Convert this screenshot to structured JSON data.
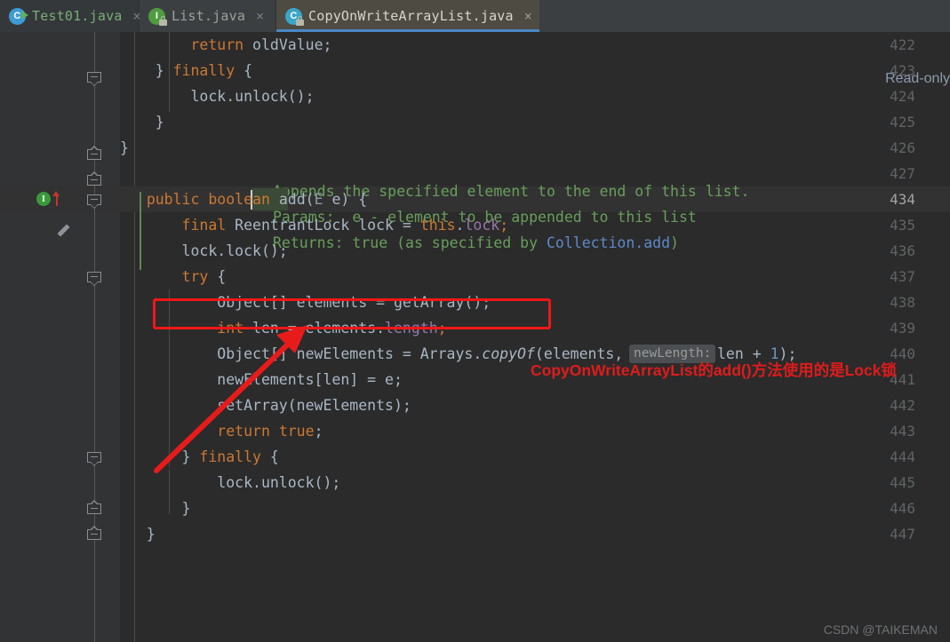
{
  "window": {
    "app": "IntelliJ IDEA editor",
    "read_only_banner": "Read-only"
  },
  "tabs": [
    {
      "label": "Test01.java",
      "icon": "java-class-runnable-icon",
      "close": "×",
      "active": false
    },
    {
      "label": "List.java",
      "icon": "java-interface-locked-icon",
      "close": "×",
      "active": false
    },
    {
      "label": "CopyOnWriteArrayList.java",
      "icon": "java-class-locked-icon",
      "close": "×",
      "active": true
    }
  ],
  "editor": {
    "first_line_number": 422,
    "gutter_icons": {
      "implements_marker": "I",
      "edit_pencil": "pencil-icon"
    },
    "caret_identifier": "add",
    "parameter_hint": "newLength:",
    "javadoc": [
      "Appends the specified element to the end of this list.",
      "Params:  e - element to be appended to this list",
      "Returns: true (as specified by ",
      "Collection.add"
    ],
    "lines": [
      {
        "n": 422,
        "text": "            return oldValue;"
      },
      {
        "n": 423,
        "text": "        } finally {"
      },
      {
        "n": 424,
        "text": "            lock.unlock();"
      },
      {
        "n": 425,
        "text": "        }"
      },
      {
        "n": 426,
        "text": "    }"
      },
      {
        "n": 427,
        "text": ""
      },
      {
        "n": 434,
        "text": "    public boolean add(E e) {"
      },
      {
        "n": 435,
        "text": "        final ReentrantLock lock = this.lock;"
      },
      {
        "n": 436,
        "text": "        lock.lock();"
      },
      {
        "n": 437,
        "text": "        try {"
      },
      {
        "n": 438,
        "text": "            Object[] elements = getArray();"
      },
      {
        "n": 439,
        "text": "            int len = elements.length;"
      },
      {
        "n": 440,
        "text": "            Object[] newElements = Arrays.copyOf(elements,  newLength: len + 1);"
      },
      {
        "n": 441,
        "text": "            newElements[len] = e;"
      },
      {
        "n": 442,
        "text": "            setArray(newElements);"
      },
      {
        "n": 443,
        "text": "            return true;"
      },
      {
        "n": 444,
        "text": "        } finally {"
      },
      {
        "n": 445,
        "text": "            lock.unlock();"
      },
      {
        "n": 446,
        "text": "        }"
      },
      {
        "n": 447,
        "text": "    }"
      }
    ]
  },
  "annotations": {
    "highlight_note": "CopyOnWriteArrayList的add()方法使用的是Lock锁",
    "box_color": "#f01717",
    "arrow_color": "#e81b1b"
  },
  "watermark": "CSDN @TAIKEMAN",
  "colors": {
    "editor_bg": "#2b2b2b",
    "gutter_bg": "#313335",
    "tabbar_bg": "#3c3f41",
    "active_tab_bg": "#4e4b42",
    "tab_underline": "#4a88c7",
    "keyword": "#cc7832",
    "plain_text": "#a9b7c6",
    "field": "#9876aa",
    "number": "#6897bb",
    "javadoc": "#629755",
    "javadoc_link": "#5c89c8",
    "current_line": "#323232"
  }
}
